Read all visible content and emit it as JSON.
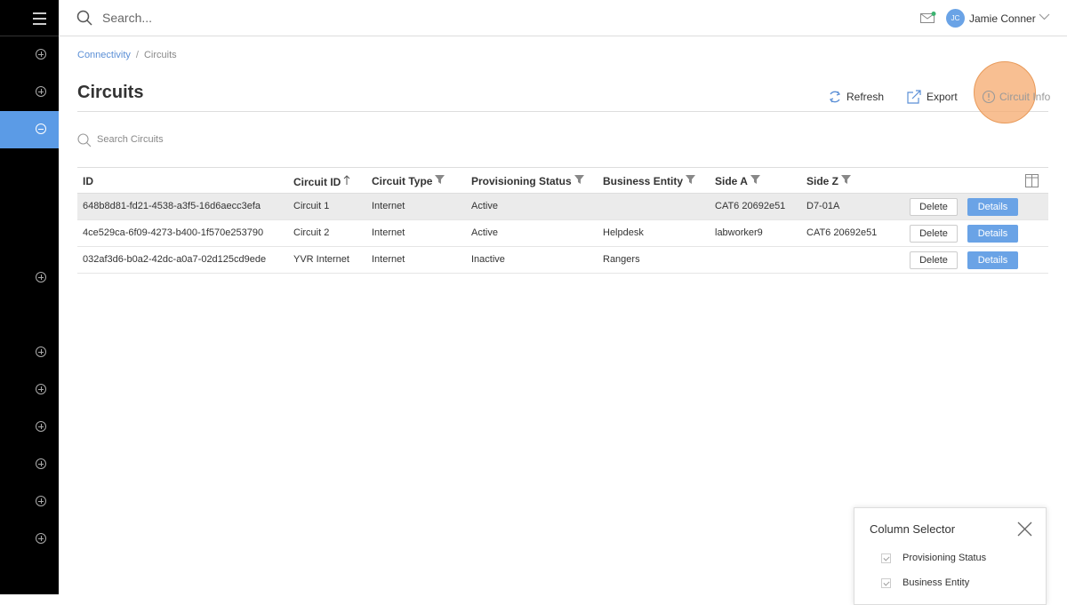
{
  "topbar": {
    "search_placeholder": "Search...",
    "user_initials": "JC",
    "user_name": "Jamie Conner"
  },
  "breadcrumb": {
    "parent": "Connectivity",
    "separator": "/",
    "current": "Circuits"
  },
  "page": {
    "title": "Circuits"
  },
  "actions": {
    "refresh": "Refresh",
    "export": "Export",
    "circuit_info": "Circuit Info"
  },
  "search": {
    "placeholder": "Search Circuits"
  },
  "table": {
    "headers": [
      "ID",
      "Circuit ID",
      "Circuit Type",
      "Provisioning Status",
      "Business Entity",
      "Side A",
      "Side Z"
    ],
    "rows": [
      {
        "id": "648b8d81-fd21-4538-a3f5-16d6aecc3efa",
        "circuit_id": "Circuit 1",
        "type": "Internet",
        "status": "Active",
        "entity": "",
        "side_a": "CAT6 20692e51",
        "side_z": "D7-01A",
        "delete": "Delete",
        "details": "Details"
      },
      {
        "id": "4ce529ca-6f09-4273-b400-1f570e253790",
        "circuit_id": "Circuit 2",
        "type": "Internet",
        "status": "Active",
        "entity": "Helpdesk",
        "side_a": "labworker9",
        "side_z": "CAT6 20692e51",
        "delete": "Delete",
        "details": "Details"
      },
      {
        "id": "032af3d6-b0a2-42dc-a0a7-02d125cd9ede",
        "circuit_id": "YVR Internet",
        "type": "Internet",
        "status": "Inactive",
        "entity": "Rangers",
        "side_a": "",
        "side_z": "",
        "delete": "Delete",
        "details": "Details"
      }
    ]
  },
  "column_selector": {
    "title": "Column Selector",
    "options": [
      {
        "label": "Provisioning Status",
        "checked": true
      },
      {
        "label": "Business Entity",
        "checked": true
      }
    ]
  },
  "colors": {
    "accent": "#6aa3e6",
    "highlight": "#f5aa6e",
    "nav_active": "#5b9be6",
    "mail_badge": "#3cb371"
  }
}
